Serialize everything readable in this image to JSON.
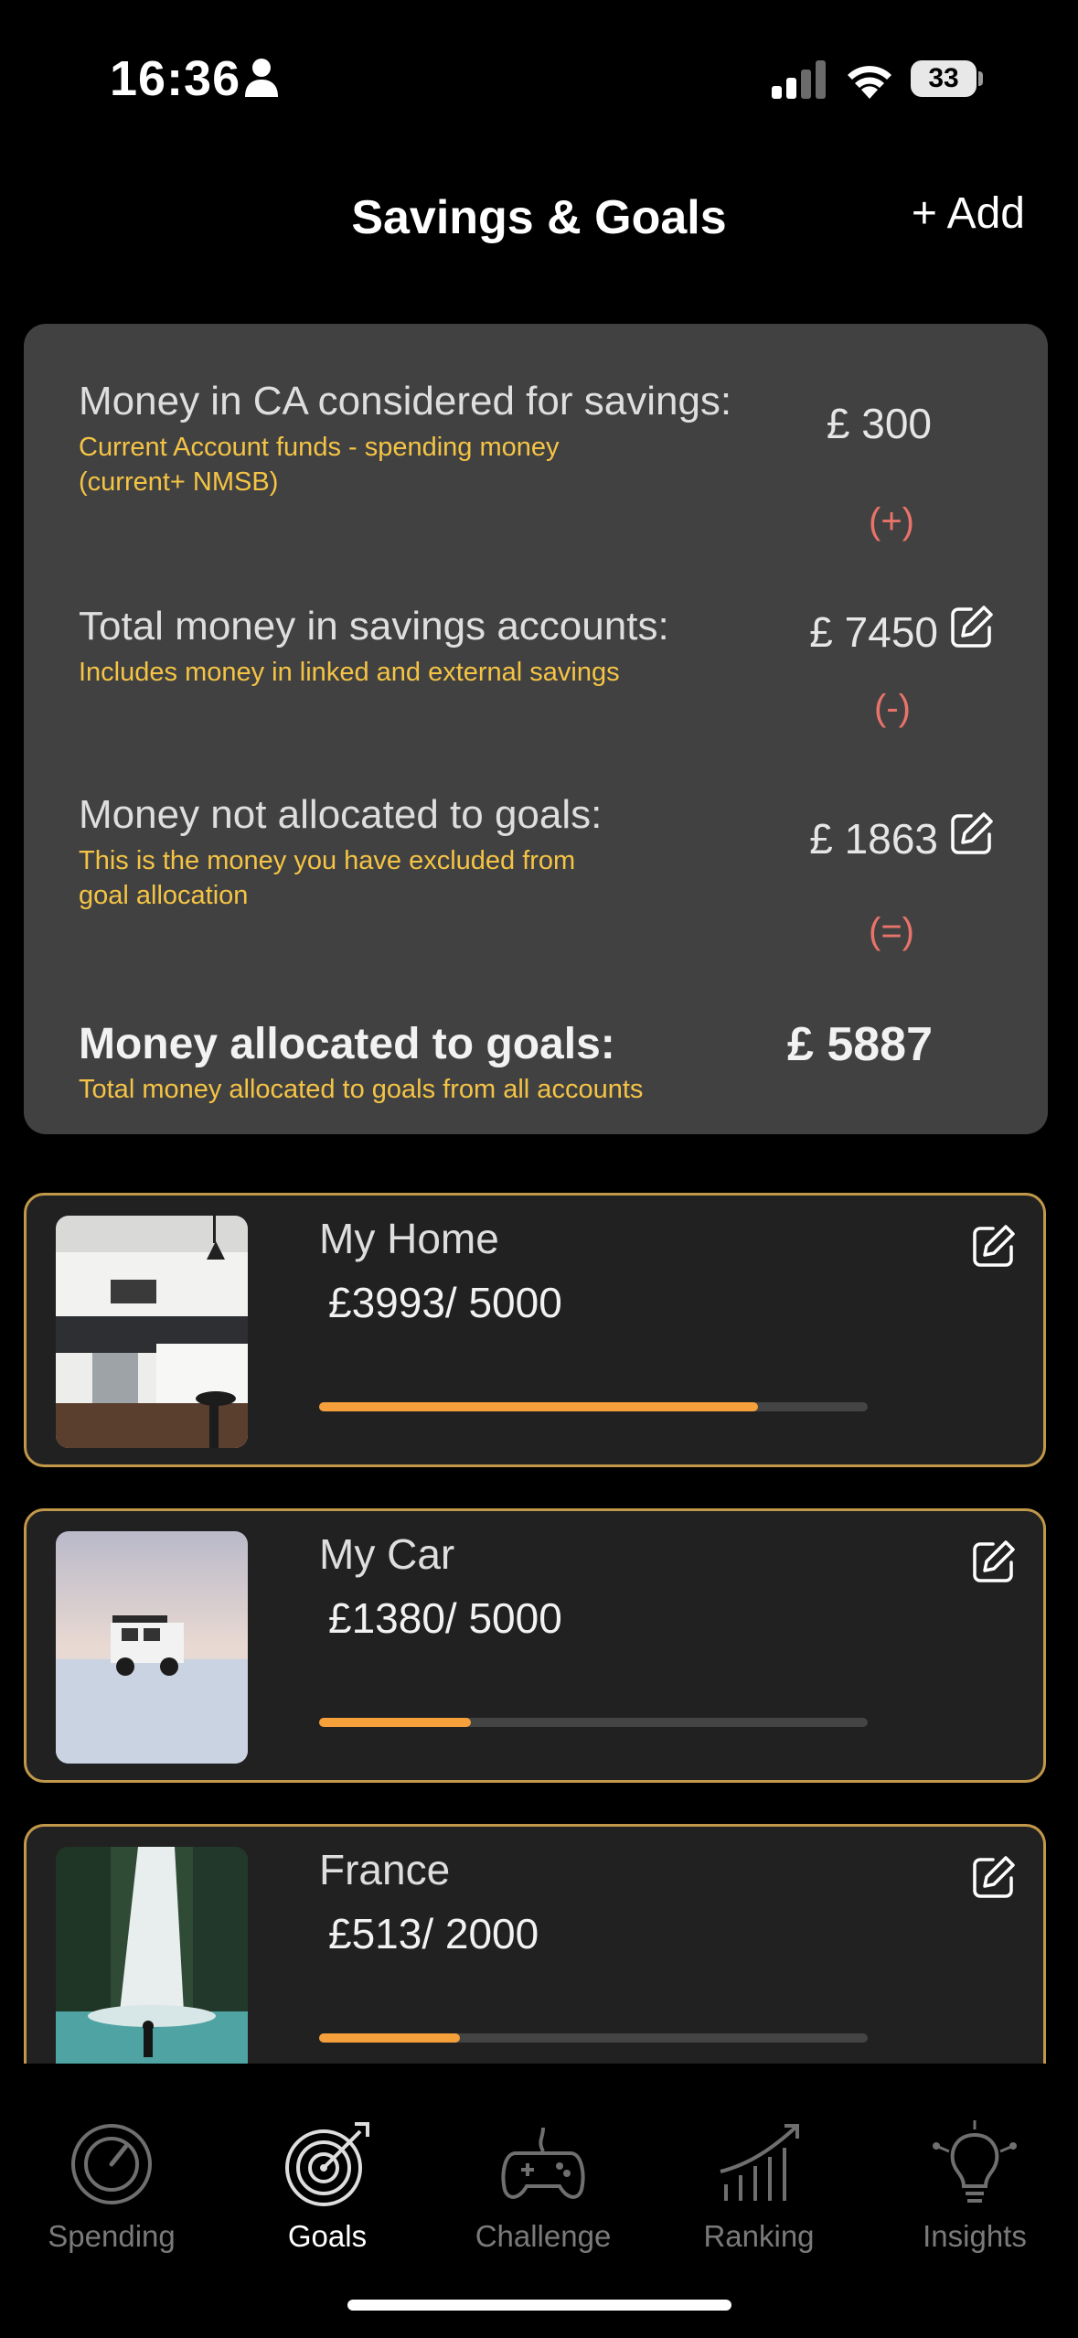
{
  "status_bar": {
    "time": "16:36",
    "battery": "33"
  },
  "header": {
    "title": "Savings & Goals",
    "add_label": "+ Add"
  },
  "summary": {
    "row1": {
      "label": "Money in CA considered for savings:",
      "sub": [
        "Current Account funds - spending money",
        "(current+ NMSB)"
      ],
      "value": "£ 300",
      "op": "(+)"
    },
    "row2": {
      "label": "Total money in savings accounts:",
      "sub": [
        "Includes money in linked and external savings"
      ],
      "value": "£ 7450",
      "op": "(-)"
    },
    "row3": {
      "label": "Money not allocated to goals:",
      "sub": [
        "This is the money you have excluded from",
        "goal allocation"
      ],
      "value": "£ 1863",
      "op": "(=)"
    },
    "row4": {
      "label": "Money allocated to goals:",
      "sub": [
        "Total money allocated to goals from all accounts"
      ],
      "value": "£ 5887"
    }
  },
  "goals": [
    {
      "name": "My Home",
      "amount": "£3993/ 5000",
      "progress": 0.8
    },
    {
      "name": "My Car",
      "amount": "£1380/ 5000",
      "progress": 0.276
    },
    {
      "name": "France",
      "amount": "£513/ 2000",
      "progress": 0.256
    }
  ],
  "tabs": [
    {
      "label": "Spending",
      "icon": "speedometer-icon",
      "active": false
    },
    {
      "label": "Goals",
      "icon": "target-icon",
      "active": true
    },
    {
      "label": "Challenge",
      "icon": "gamepad-icon",
      "active": false
    },
    {
      "label": "Ranking",
      "icon": "ranking-chart-icon",
      "active": false
    },
    {
      "label": "Insights",
      "icon": "lightbulb-icon",
      "active": false
    }
  ],
  "colors": {
    "accent": "#f5a03a",
    "subtext": "#f5c445",
    "operator": "#e8736a",
    "card": "#414141",
    "goal_border": "#c19849"
  }
}
